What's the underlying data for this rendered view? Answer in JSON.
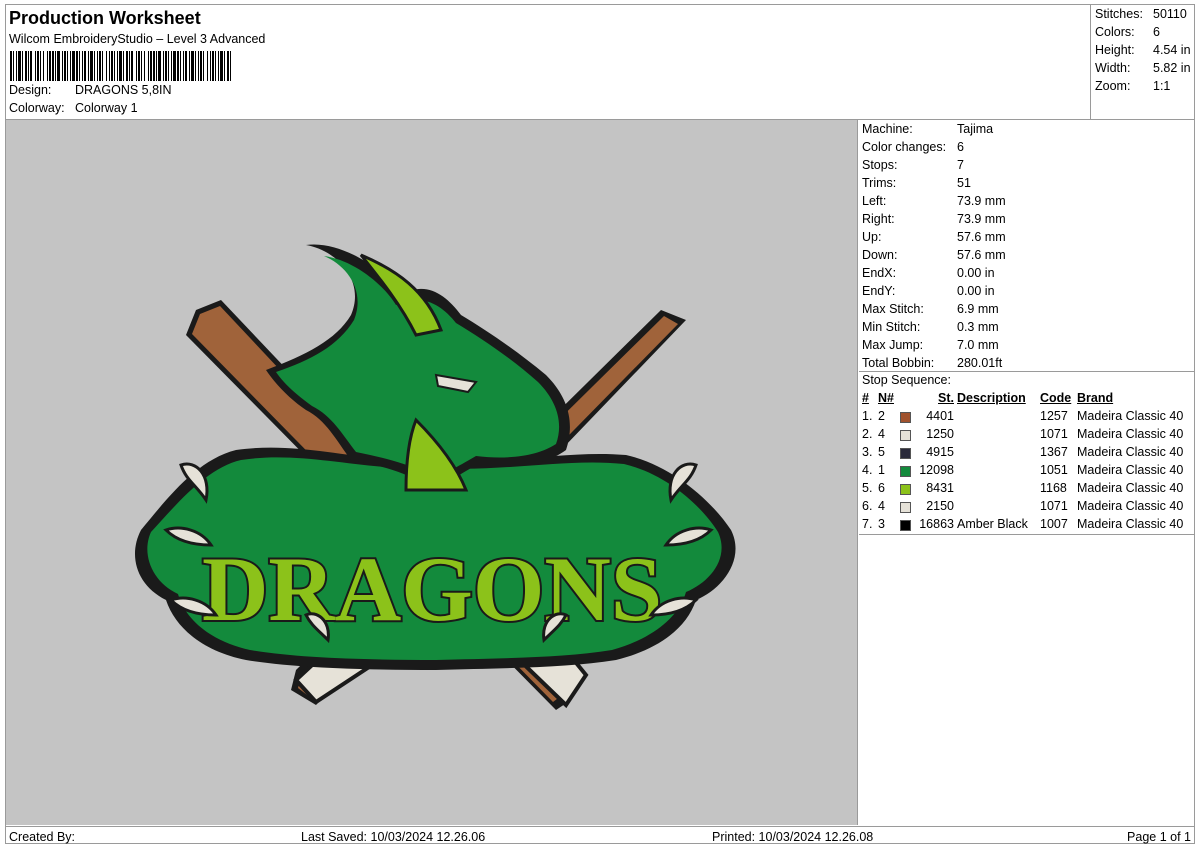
{
  "header": {
    "title": "Production Worksheet",
    "software": "Wilcom EmbroideryStudio – Level 3 Advanced",
    "design_label": "Design:",
    "design_value": "DRAGONS 5,8IN",
    "colorway_label": "Colorway:",
    "colorway_value": "Colorway 1"
  },
  "summary": [
    {
      "label": "Stitches:",
      "value": "50110"
    },
    {
      "label": "Colors:",
      "value": "6"
    },
    {
      "label": "Height:",
      "value": "4.54 in"
    },
    {
      "label": "Width:",
      "value": "5.82 in"
    },
    {
      "label": "Zoom:",
      "value": "1:1"
    }
  ],
  "machine_info": [
    {
      "label": "Machine:",
      "value": "Tajima"
    },
    {
      "label": "Color changes:",
      "value": "6"
    },
    {
      "label": "Stops:",
      "value": "7"
    },
    {
      "label": "Trims:",
      "value": "51"
    },
    {
      "label": "Left:",
      "value": "73.9 mm"
    },
    {
      "label": "Right:",
      "value": "73.9 mm"
    },
    {
      "label": "Up:",
      "value": "57.6 mm"
    },
    {
      "label": "Down:",
      "value": "57.6 mm"
    },
    {
      "label": "EndX:",
      "value": "0.00 in"
    },
    {
      "label": "EndY:",
      "value": "0.00 in"
    },
    {
      "label": "Max Stitch:",
      "value": "6.9 mm"
    },
    {
      "label": "Min Stitch:",
      "value": "0.3 mm"
    },
    {
      "label": "Max Jump:",
      "value": "7.0 mm"
    },
    {
      "label": "Total Bobbin:",
      "value": "280.01ft"
    }
  ],
  "stop_sequence": {
    "title": "Stop Sequence:",
    "headers": {
      "idx": "#",
      "needle": "N#",
      "stitches": "St.",
      "description": "Description",
      "code": "Code",
      "brand": "Brand"
    },
    "rows": [
      {
        "idx": "1.",
        "needle": "2",
        "color": "#a0522d",
        "stitches": "4401",
        "description": "",
        "code": "1257",
        "brand": "Madeira Classic 40"
      },
      {
        "idx": "2.",
        "needle": "4",
        "color": "#e6e2d8",
        "stitches": "1250",
        "description": "",
        "code": "1071",
        "brand": "Madeira Classic 40"
      },
      {
        "idx": "3.",
        "needle": "5",
        "color": "#2a2a3a",
        "stitches": "4915",
        "description": "",
        "code": "1367",
        "brand": "Madeira Classic 40"
      },
      {
        "idx": "4.",
        "needle": "1",
        "color": "#138a3c",
        "stitches": "12098",
        "description": "",
        "code": "1051",
        "brand": "Madeira Classic 40"
      },
      {
        "idx": "5.",
        "needle": "6",
        "color": "#8cc21a",
        "stitches": "8431",
        "description": "",
        "code": "1168",
        "brand": "Madeira Classic 40"
      },
      {
        "idx": "6.",
        "needle": "4",
        "color": "#e6e2d8",
        "stitches": "2150",
        "description": "",
        "code": "1071",
        "brand": "Madeira Classic 40"
      },
      {
        "idx": "7.",
        "needle": "3",
        "color": "#000000",
        "stitches": "16863",
        "description": "Amber Black",
        "code": "1007",
        "brand": "Madeira Classic 40"
      }
    ]
  },
  "preview": {
    "logo_text": "DRAGONS",
    "colors": {
      "background": "#c4c4c4",
      "bat": "#a0633a",
      "bat_light": "#e6e2d8",
      "outline": "#1a1a1a",
      "green_dark": "#138a3c",
      "green_light": "#8cc21a"
    }
  },
  "footer": {
    "created_by": "Created By:",
    "last_saved": "Last Saved: 10/03/2024 12.26.06",
    "printed": "Printed: 10/03/2024 12.26.08",
    "page": "Page 1 of 1"
  }
}
